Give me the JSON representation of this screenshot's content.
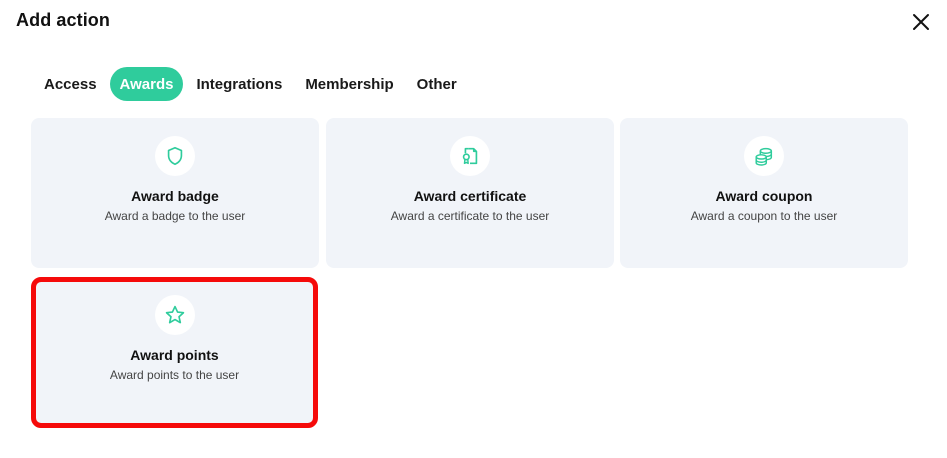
{
  "dialog": {
    "title": "Add action",
    "close_icon": "close-icon"
  },
  "tabs": [
    {
      "label": "Access",
      "active": false
    },
    {
      "label": "Awards",
      "active": true
    },
    {
      "label": "Integrations",
      "active": false
    },
    {
      "label": "Membership",
      "active": false
    },
    {
      "label": "Other",
      "active": false
    }
  ],
  "cards": [
    {
      "title": "Award badge",
      "description": "Award a badge to the user",
      "icon": "shield-icon"
    },
    {
      "title": "Award certificate",
      "description": "Award a certificate to the user",
      "icon": "certificate-icon"
    },
    {
      "title": "Award coupon",
      "description": "Award a coupon to the user",
      "icon": "coins-icon"
    },
    {
      "title": "Award points",
      "description": "Award points to the user",
      "icon": "star-icon",
      "highlighted": true
    }
  ],
  "colors": {
    "accent": "#2fcc9c",
    "card_bg": "#f1f4f9",
    "highlight_border": "#f50a0a"
  }
}
